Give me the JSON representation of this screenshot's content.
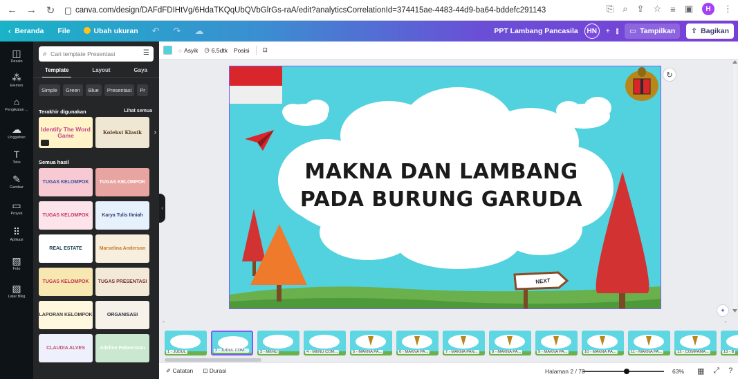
{
  "browser": {
    "url": "canva.com/design/DAFdFDIHtVg/6HdaTKQqUbQVbGlrGs-raA/edit?analyticsCorrelationId=374415ae-4483-44d9-ba64-bddefc291143",
    "profile_initial": "H"
  },
  "topbar": {
    "home": "Beranda",
    "file": "File",
    "resize": "Ubah ukuran",
    "title": "PPT Lambang Pancasila",
    "avatar": "HN",
    "present": "Tampilkan",
    "share": "Bagikan"
  },
  "rail": {
    "items": [
      "Desain",
      "Elemen",
      "Pengikatan ...",
      "Unggahan",
      "Teks",
      "Gambar",
      "Proyek",
      "Aplikasi",
      "Foto",
      "Latar Blkg"
    ]
  },
  "panel": {
    "search_placeholder": "Cari template Presentasi",
    "tabs": [
      "Template",
      "Layout",
      "Gaya"
    ],
    "chips": [
      "Simple",
      "Green",
      "Blue",
      "Presentasi",
      "Pr"
    ],
    "recent_heading": "Terakhir digunakan",
    "see_all": "Lihat semua",
    "recent": [
      {
        "title": "Identify The Word Game"
      },
      {
        "title": "Koleksi Klasik"
      }
    ],
    "all_heading": "Semua hasil",
    "templates": [
      {
        "title": "TUGAS KELOMPOK",
        "bg": "#f6c9d3",
        "fg": "#3d4f9a"
      },
      {
        "title": "TUGAS KELOMPOK",
        "bg": "#e8a4a0",
        "fg": "#ffffff"
      },
      {
        "title": "TUGAS KELOMPOK",
        "bg": "#fde3ea",
        "fg": "#c13a6a"
      },
      {
        "title": "Karya Tulis Ilmiah",
        "bg": "#e7f1fb",
        "fg": "#2e3c78"
      },
      {
        "title": "REAL ESTATE",
        "bg": "#ffffff",
        "fg": "#173c4f"
      },
      {
        "title": "Marselina Anderson",
        "bg": "#f7eedd",
        "fg": "#c57b2e"
      },
      {
        "title": "TUGAS KELOMPOK",
        "bg": "#f7e7b1",
        "fg": "#c2344b"
      },
      {
        "title": "TUGAS PRESENTASI",
        "bg": "#f2e9d8",
        "fg": "#7b2e2e"
      },
      {
        "title": "LAPORAN KELOMPOK",
        "bg": "#fff8df",
        "fg": "#3a3a3a"
      },
      {
        "title": "ORGANISASI",
        "bg": "#f6f2ea",
        "fg": "#2a2a3c"
      },
      {
        "title": "CLAUDIA ALVES",
        "bg": "#eef0fb",
        "fg": "#c0527a"
      },
      {
        "title": "Adeline Palmerston",
        "bg": "#c9e8cf",
        "fg": "#ffffff"
      }
    ]
  },
  "toolbar": {
    "animation": "Asyik",
    "duration": "6.5dtk",
    "position": "Posisi",
    "color": "#52d2de"
  },
  "slide": {
    "title_line1": "MAKNA DAN LAMBANG",
    "title_line2": "PADA BURUNG GARUDA",
    "next_label": "NEXT",
    "sky": "#52d2de",
    "grass": "#6ab04c"
  },
  "filmstrip": {
    "pages": [
      "1 - JUDUL",
      "2 - JUDUL COM...",
      "3 - MENU",
      "4 - MENU COM...",
      "5 - MAKNA PA...",
      "6 - MAKNA PA...",
      "7 - MAKNA PAN...",
      "8 - MAKNA PA...",
      "9 - MAKNA PA...",
      "10 - MAKNA PA...",
      "11 - MAKNA PA...",
      "12 - COMPAMA...",
      "13 - B"
    ],
    "selected_index": 1
  },
  "status": {
    "notes": "Catatan",
    "duration": "Durasi",
    "page": "Halaman 2 / 73",
    "zoom": "63%",
    "zoom_fraction": 0.52
  }
}
